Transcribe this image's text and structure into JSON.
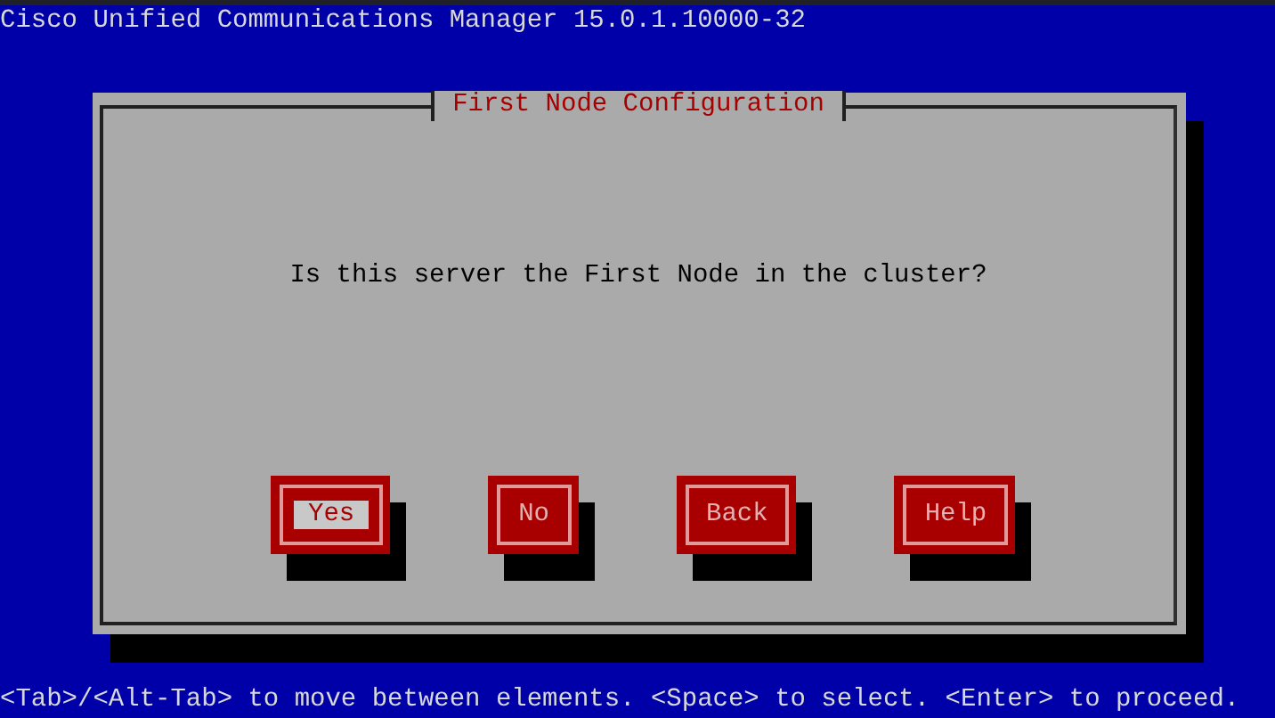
{
  "header": {
    "title": "Cisco Unified Communications Manager 15.0.1.10000-32"
  },
  "dialog": {
    "title": "First Node Configuration",
    "question": "Is this server the First Node in the cluster?",
    "buttons": [
      {
        "label": "Yes",
        "selected": true
      },
      {
        "label": "No",
        "selected": false
      },
      {
        "label": "Back",
        "selected": false
      },
      {
        "label": "Help",
        "selected": false
      }
    ]
  },
  "status_bar": {
    "hint": "<Tab>/<Alt-Tab> to move between elements. <Space> to select. <Enter> to proceed."
  }
}
